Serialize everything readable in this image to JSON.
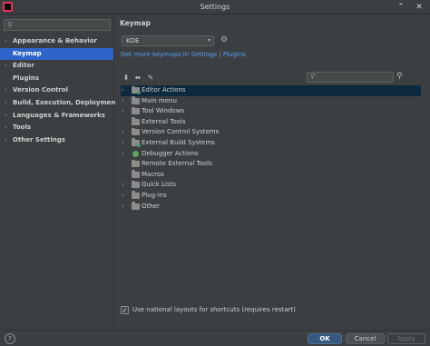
{
  "window": {
    "title": "Settings",
    "min_symbol": "⌃",
    "close_symbol": "✕"
  },
  "sidebar": {
    "search_placeholder": "",
    "items": [
      {
        "label": "Appearance & Behavior",
        "arrow": "›"
      },
      {
        "label": "Keymap",
        "arrow": ""
      },
      {
        "label": "Editor",
        "arrow": "›"
      },
      {
        "label": "Plugins",
        "arrow": ""
      },
      {
        "label": "Version Control",
        "arrow": "›"
      },
      {
        "label": "Build, Execution, Deployment",
        "arrow": "›"
      },
      {
        "label": "Languages & Frameworks",
        "arrow": "›"
      },
      {
        "label": "Tools",
        "arrow": "›"
      },
      {
        "label": "Other Settings",
        "arrow": "›"
      }
    ],
    "selected_index": 1
  },
  "content": {
    "breadcrumb": "Keymap",
    "keymap_select": {
      "value": "KDE",
      "caret": "▾"
    },
    "gear_icon": "⚙",
    "links": {
      "get_more": "Get more keymaps in Settings",
      "separator": "|",
      "plugins": "Plugins"
    },
    "toolbar": {
      "expand_all": "⬍",
      "collapse_all": "⬌",
      "edit": "✎"
    },
    "filter_placeholder": "",
    "find_by_shortcut_icon": "⚲",
    "tree": [
      {
        "label": "Editor Actions",
        "icon": "folder-gear",
        "expandable": true,
        "selected": true
      },
      {
        "label": "Main menu",
        "icon": "folder",
        "expandable": true
      },
      {
        "label": "Tool Windows",
        "icon": "folder",
        "expandable": true
      },
      {
        "label": "External Tools",
        "icon": "folder",
        "expandable": false
      },
      {
        "label": "Version Control Systems",
        "icon": "folder",
        "expandable": true
      },
      {
        "label": "External Build Systems",
        "icon": "folder-gear",
        "expandable": true
      },
      {
        "label": "Debugger Actions",
        "icon": "bug",
        "expandable": true
      },
      {
        "label": "Remote External Tools",
        "icon": "folder",
        "expandable": false
      },
      {
        "label": "Macros",
        "icon": "folder",
        "expandable": false
      },
      {
        "label": "Quick Lists",
        "icon": "folder",
        "expandable": true
      },
      {
        "label": "Plug-ins",
        "icon": "folder",
        "expandable": true
      },
      {
        "label": "Other",
        "icon": "folder",
        "expandable": true
      }
    ],
    "national_layouts": {
      "checked": true,
      "check_mark": "✓",
      "label": "Use national layouts for shortcuts (requires restart)"
    }
  },
  "footer": {
    "help": "?",
    "ok": "OK",
    "cancel": "Cancel",
    "apply": "Apply"
  }
}
